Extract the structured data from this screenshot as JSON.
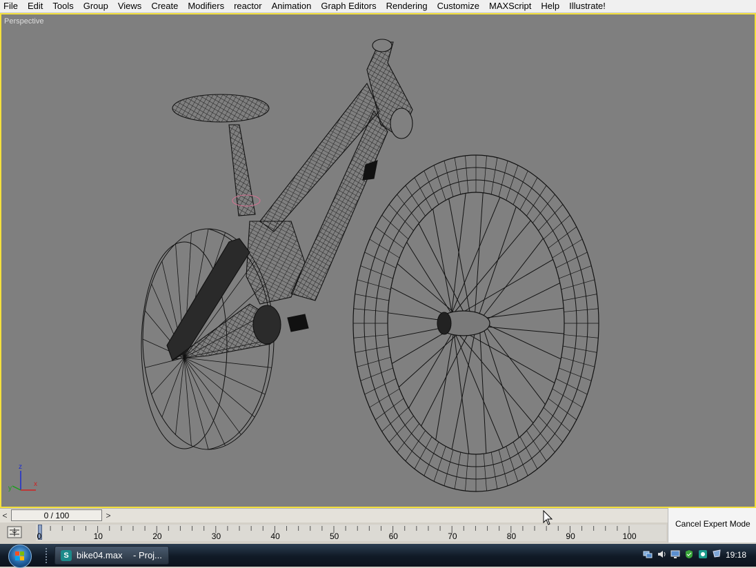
{
  "menu": {
    "items": [
      "File",
      "Edit",
      "Tools",
      "Group",
      "Views",
      "Create",
      "Modifiers",
      "reactor",
      "Animation",
      "Graph Editors",
      "Rendering",
      "Customize",
      "MAXScript",
      "Help",
      "Illustrate!"
    ]
  },
  "viewport": {
    "label": "Perspective",
    "background": "#7f7f7f",
    "border_color": "#f5e13c",
    "axis": {
      "z": "z",
      "y": "y",
      "x": "x"
    }
  },
  "timeline": {
    "slider_value": "0 / 100",
    "current_frame": 0,
    "total_frames": 100,
    "tick_labels": [
      "0",
      "10",
      "20",
      "30",
      "40",
      "50",
      "60",
      "70",
      "80",
      "90",
      "100"
    ],
    "prev_arrow": "<",
    "next_arrow": ">"
  },
  "expert_mode": {
    "cancel_label": "Cancel Expert Mode"
  },
  "taskbar": {
    "app_file": "bike04.max",
    "app_project": "- Proj...",
    "clock": "19:18",
    "tray_icons": [
      "network-icon",
      "volume-icon",
      "display-icon",
      "security-icon",
      "app-tray-icon",
      "messenger-icon"
    ]
  }
}
